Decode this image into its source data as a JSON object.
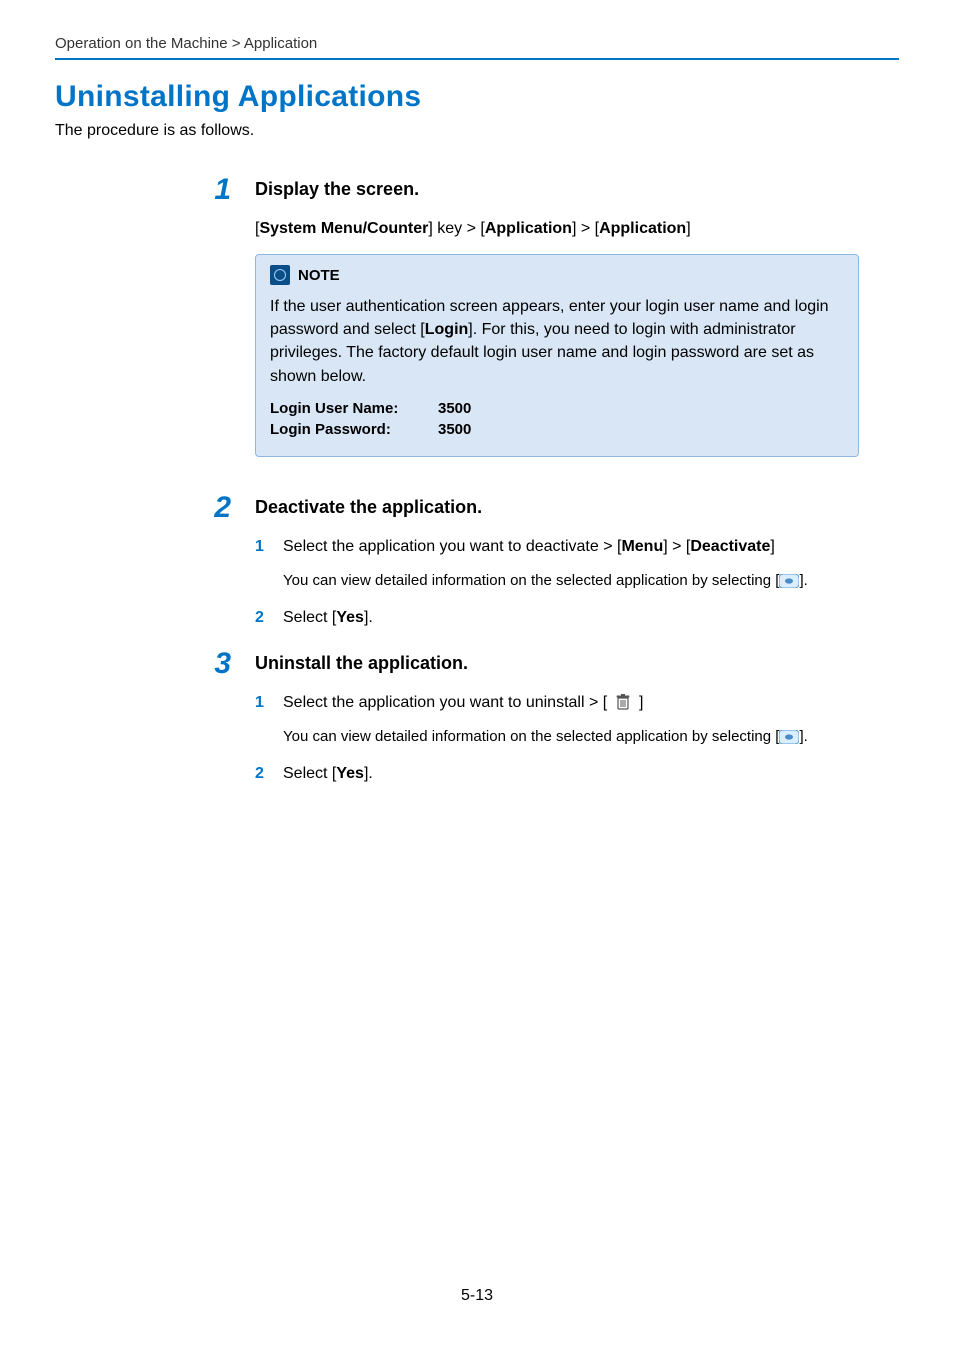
{
  "breadcrumb": "Operation on the Machine > Application",
  "title": "Uninstalling Applications",
  "intro": "The procedure is as follows.",
  "steps": [
    {
      "num": "1",
      "heading": "Display the screen.",
      "path_parts": {
        "p0": "[",
        "p1": "System Menu/Counter",
        "p2": "] key > [",
        "p3": "Application",
        "p4": "] > [",
        "p5": "Application",
        "p6": "]"
      },
      "note": {
        "label": "NOTE",
        "body_parts": {
          "t0": "If the user authentication screen appears, enter your login user name and login password and select [",
          "t1": "Login",
          "t2": "]. For this, you need to login with administrator privileges. The factory default login user name and login password are set as shown below."
        },
        "creds": [
          {
            "label": "Login User Name:",
            "value": "3500"
          },
          {
            "label": "Login Password:",
            "value": "3500"
          }
        ]
      }
    },
    {
      "num": "2",
      "heading": "Deactivate the application.",
      "subs": [
        {
          "n": "1",
          "parts": {
            "a": "Select the application you want to deactivate > [",
            "b": "Menu",
            "c": "] > [",
            "d": "Deactivate",
            "e": "]"
          },
          "note_pre": "You can view detailed information on the selected application by selecting [",
          "note_post": "]."
        },
        {
          "n": "2",
          "parts": {
            "a": "Select [",
            "b": "Yes",
            "c": "]."
          }
        }
      ]
    },
    {
      "num": "3",
      "heading": "Uninstall the application.",
      "subs": [
        {
          "n": "1",
          "parts": {
            "a": "Select the application you want to uninstall > ["
          },
          "suffix": "]",
          "note_pre": "You can view detailed information on the selected application by selecting [",
          "note_post": "]."
        },
        {
          "n": "2",
          "parts": {
            "a": "Select [",
            "b": "Yes",
            "c": "]."
          }
        }
      ]
    }
  ],
  "page_number": "5-13"
}
